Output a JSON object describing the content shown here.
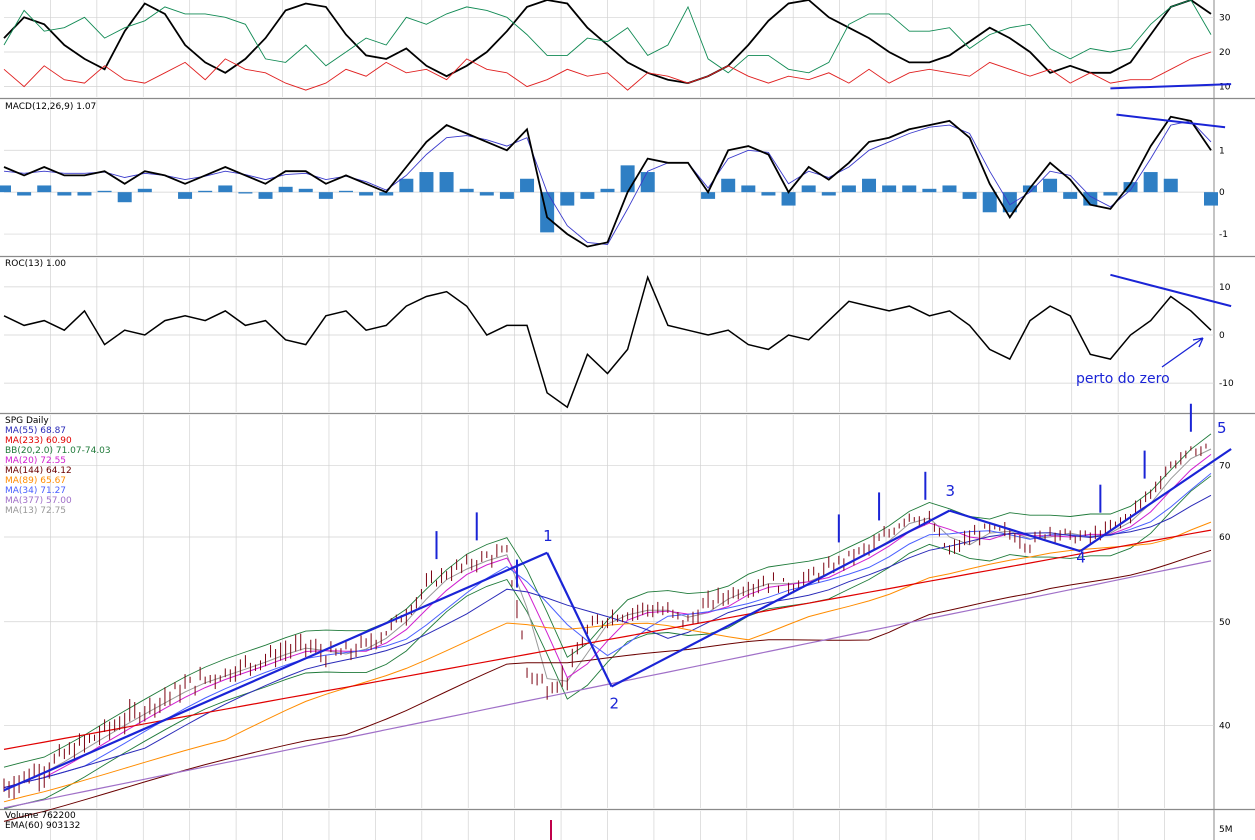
{
  "chart_data": {
    "type": "line",
    "symbol_title": "SPG Daily",
    "grid": true,
    "colors": {
      "wave": "#1a24d6",
      "price": "#7a0010",
      "ma55": "#2a2ab8",
      "ma233": "#e00000",
      "bb": "#1f7a3a",
      "ma20": "#d020d0",
      "ma144": "#6a0000",
      "ma89": "#ff8c00",
      "ma34": "#4a60ff",
      "ma377": "#a070c8",
      "ma13": "#999999",
      "macd_hist": "#2f7fc4"
    },
    "panels": [
      {
        "id": "dmi",
        "ylim": [
          7,
          35
        ],
        "ticks": [
          10,
          20,
          30
        ],
        "series": [
          {
            "key": "black",
            "color": "#000000",
            "values": [
              24,
              30,
              28,
              22,
              18,
              15,
              26,
              34,
              31,
              22,
              17,
              14,
              18,
              24,
              32,
              34,
              33,
              25,
              19,
              18,
              21,
              16,
              13,
              16,
              20,
              26,
              33,
              35,
              34,
              27,
              22,
              17,
              14,
              12,
              11,
              13,
              16,
              22,
              29,
              34,
              35,
              30,
              27,
              24,
              20,
              17,
              17,
              19,
              23,
              27,
              24,
              20,
              14,
              16,
              14,
              14,
              17,
              25,
              33,
              35,
              31
            ]
          },
          {
            "key": "green",
            "color": "#118a54",
            "values": [
              22,
              32,
              26,
              27,
              30,
              24,
              27,
              29,
              33,
              31,
              31,
              30,
              28,
              18,
              17,
              22,
              16,
              20,
              24,
              22,
              30,
              28,
              31,
              33,
              32,
              30,
              25,
              19,
              19,
              24,
              23,
              27,
              19,
              22,
              33,
              18,
              14,
              19,
              19,
              15,
              14,
              17,
              28,
              31,
              31,
              26,
              26,
              27,
              21,
              25,
              27,
              28,
              21,
              18,
              21,
              20,
              21,
              28,
              33,
              35,
              25
            ]
          },
          {
            "key": "red",
            "color": "#e02020",
            "values": [
              15,
              10,
              16,
              12,
              11,
              16,
              12,
              11,
              14,
              17,
              12,
              18,
              15,
              14,
              11,
              9,
              11,
              15,
              13,
              17,
              14,
              15,
              12,
              18,
              15,
              14,
              10,
              12,
              15,
              13,
              14,
              9,
              14,
              13,
              11,
              13,
              16,
              13,
              11,
              13,
              12,
              14,
              11,
              15,
              11,
              14,
              15,
              14,
              13,
              17,
              15,
              13,
              15,
              11,
              14,
              11,
              12,
              12,
              15,
              18,
              20
            ]
          }
        ],
        "trendline": {
          "from": [
            55,
            9.5
          ],
          "to": [
            61,
            10.7
          ]
        }
      },
      {
        "id": "macd",
        "label": "MACD(12,26,9)",
        "last_value": "1.07",
        "ylim": [
          -1.5,
          2.2
        ],
        "ticks": [
          {
            "v": 1,
            "t": "1"
          },
          {
            "v": 0,
            "t": "0"
          },
          {
            "v": -1,
            "t": "-1"
          }
        ],
        "macd": [
          0.6,
          0.4,
          0.6,
          0.4,
          0.4,
          0.5,
          0.2,
          0.5,
          0.4,
          0.2,
          0.4,
          0.6,
          0.4,
          0.2,
          0.5,
          0.5,
          0.2,
          0.4,
          0.2,
          0,
          0.6,
          1.2,
          1.6,
          1.4,
          1.2,
          1.0,
          1.5,
          -0.6,
          -1.0,
          -1.3,
          -1.2,
          0,
          0.8,
          0.7,
          0.7,
          0,
          1.0,
          1.1,
          0.9,
          0,
          0.6,
          0.3,
          0.7,
          1.2,
          1.3,
          1.5,
          1.6,
          1.7,
          1.3,
          0.2,
          -0.6,
          0.1,
          0.7,
          0.3,
          -0.3,
          -0.4,
          0.2,
          1.1,
          1.8,
          1.7,
          1.0
        ],
        "signal": [
          0.5,
          0.45,
          0.5,
          0.45,
          0.45,
          0.48,
          0.35,
          0.45,
          0.4,
          0.3,
          0.38,
          0.5,
          0.42,
          0.3,
          0.42,
          0.45,
          0.3,
          0.38,
          0.25,
          0.05,
          0.4,
          0.9,
          1.3,
          1.35,
          1.25,
          1.1,
          1.3,
          0,
          -0.8,
          -1.2,
          -1.25,
          -0.4,
          0.5,
          0.7,
          0.7,
          0.1,
          0.8,
          1.0,
          0.95,
          0.2,
          0.5,
          0.35,
          0.6,
          1.0,
          1.2,
          1.4,
          1.55,
          1.6,
          1.4,
          0.5,
          -0.3,
          0,
          0.5,
          0.4,
          -0.1,
          -0.35,
          0.05,
          0.8,
          1.6,
          1.7,
          1.2
        ],
        "trendline": {
          "from": [
            55.3,
            1.85
          ],
          "to": [
            60.7,
            1.55
          ]
        }
      },
      {
        "id": "roc",
        "label": "ROC(13)",
        "last_value": "1.00",
        "ylim": [
          -16,
          16
        ],
        "ticks": [
          {
            "v": 10,
            "t": "10"
          },
          {
            "v": 0,
            "t": "0"
          },
          {
            "v": -10,
            "t": "-10"
          }
        ],
        "values": [
          4,
          2,
          3,
          1,
          5,
          -2,
          1,
          0,
          3,
          4,
          3,
          5,
          2,
          3,
          -1,
          -2,
          4,
          5,
          1,
          2,
          6,
          8,
          9,
          6,
          0,
          2,
          2,
          -12,
          -15,
          -4,
          -8,
          -3,
          12,
          2,
          1,
          0,
          1,
          -2,
          -3,
          0,
          -1,
          3,
          7,
          6,
          5,
          6,
          4,
          5,
          2,
          -3,
          -5,
          3,
          6,
          4,
          -4,
          -5,
          0,
          3,
          8,
          5,
          1
        ],
        "trendline": {
          "from": [
            55,
            12.5
          ],
          "to": [
            61,
            6
          ]
        }
      },
      {
        "id": "price",
        "ylim": [
          33.5,
          78
        ],
        "ticks": [
          {
            "v": 70,
            "t": "70"
          },
          {
            "v": 60,
            "t": "60"
          },
          {
            "v": 50,
            "t": "50"
          },
          {
            "v": 40,
            "t": "40"
          }
        ],
        "legend": [
          {
            "text": "SPG Daily",
            "color": "#000000"
          },
          {
            "text": "MA(55) 68.87",
            "color": "#2a2ab8"
          },
          {
            "text": "MA(233) 60.90",
            "color": "#e00000"
          },
          {
            "text": "BB(20,2.0) 71.07-74.03",
            "color": "#1f7a3a"
          },
          {
            "text": "MA(20) 72.55",
            "color": "#d020d0"
          },
          {
            "text": "MA(144) 64.12",
            "color": "#6a0000"
          },
          {
            "text": "MA(89) 65.67",
            "color": "#ff8c00"
          },
          {
            "text": "MA(34) 71.27",
            "color": "#4a60ff"
          },
          {
            "text": "MA(377) 57.00",
            "color": "#a070c8"
          },
          {
            "text": "MA(13) 72.75",
            "color": "#999999"
          }
        ],
        "close": [
          35,
          35.8,
          36.5,
          37.5,
          38.5,
          39.5,
          40.5,
          41.5,
          42.5,
          43.5,
          44.2,
          44.8,
          45.5,
          46.2,
          47.0,
          47.5,
          46.5,
          46.8,
          47.5,
          49,
          51,
          54,
          55.5,
          56.5,
          57.5,
          58,
          45,
          43.5,
          44.5,
          49,
          50.5,
          51,
          51.5,
          51,
          50,
          52,
          53,
          54,
          54.5,
          54,
          55,
          56,
          57.5,
          58.5,
          60.5,
          63,
          62,
          58,
          60,
          61,
          60.5,
          59,
          61,
          60,
          60,
          61,
          63,
          66,
          70,
          72,
          73
        ],
        "ma_curves": [
          {
            "key": "ma233",
            "color": "#e00000",
            "from": 30,
            "to": 61,
            "values_start": 38,
            "values_end": 60.9
          },
          {
            "key": "ma377",
            "color": "#a070c8",
            "from": 33.5,
            "to": 57,
            "values_start": 33.5,
            "values_end": 57.0
          }
        ],
        "wave_lines": [
          {
            "from": [
              0,
              34.8
            ],
            "to": [
              27,
              58
            ]
          },
          {
            "from": [
              27,
              58
            ],
            "to": [
              30.2,
              43.5
            ]
          },
          {
            "from": [
              30.2,
              43.5
            ],
            "to": [
              47,
              63.5
            ]
          },
          {
            "from": [
              47,
              63.5
            ],
            "to": [
              53.5,
              58.2
            ]
          },
          {
            "from": [
              53.5,
              58.2
            ],
            "to": [
              61,
              72.5
            ]
          }
        ],
        "wave_labels": [
          {
            "text": "1",
            "x": 27,
            "y": 59.5
          },
          {
            "text": "2",
            "x": 30.3,
            "y": 41.5
          },
          {
            "text": "3",
            "x": 47,
            "y": 65.5
          },
          {
            "text": "4",
            "x": 53.5,
            "y": 56.8
          },
          {
            "text": "5",
            "x": 60.5,
            "y": 75
          }
        ],
        "tick_marks_x": [
          21.5,
          23.5,
          25.5,
          41.5,
          43.5,
          45.8,
          54.5,
          56.7,
          59
        ]
      },
      {
        "id": "volume",
        "label": "Volume",
        "volume_value": "762200",
        "ema_label": "EMA(60)",
        "ema_value": "903132",
        "tick": "5M"
      }
    ],
    "annotation": "perto do zero"
  }
}
